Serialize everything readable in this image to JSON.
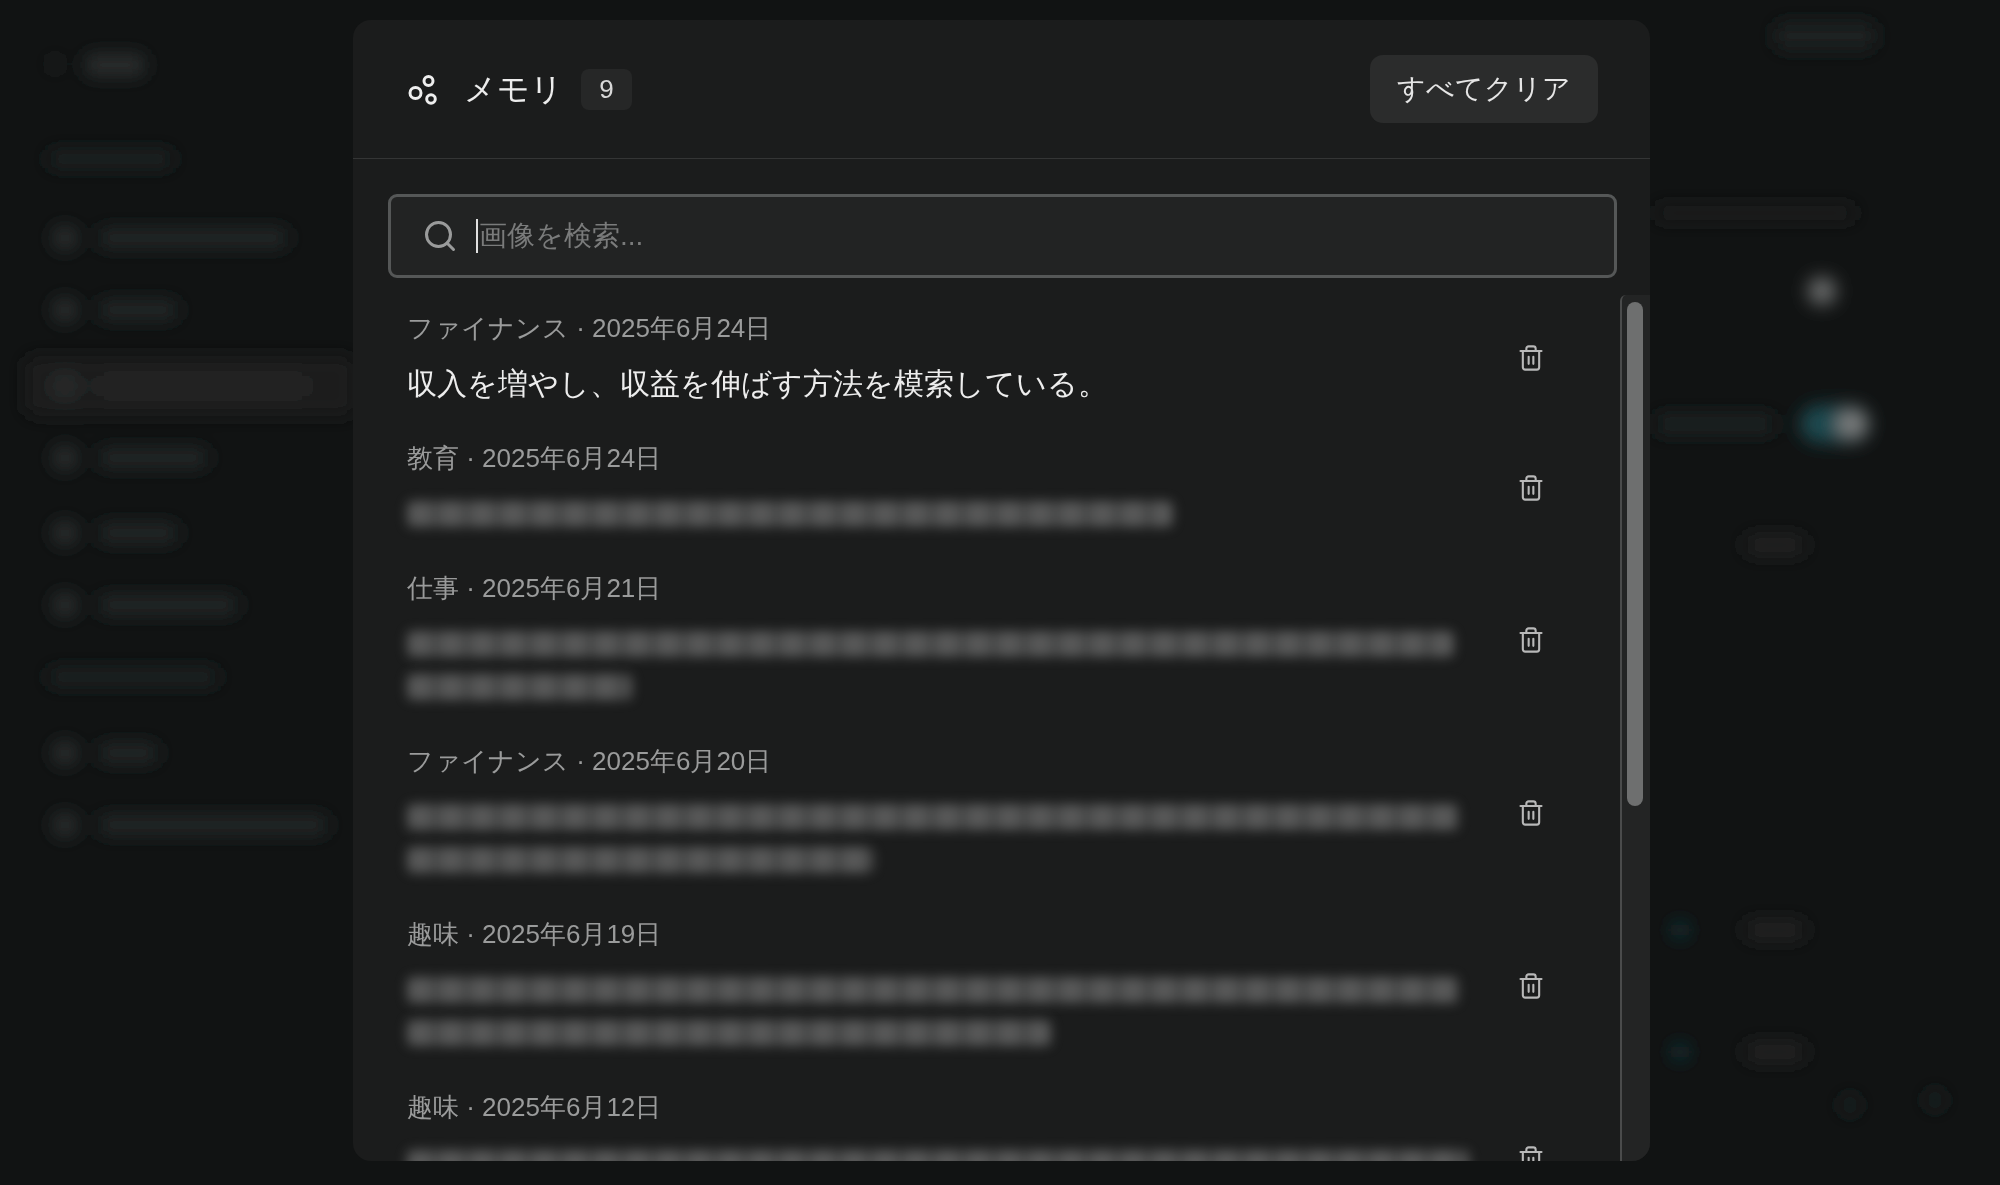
{
  "header": {
    "title": "メモリ",
    "count": "9",
    "clear_button": "すべてクリア"
  },
  "search": {
    "placeholder": "画像を検索...",
    "focused": true
  },
  "memories": [
    {
      "meta": "ファイナンス · 2025年6月24日",
      "text": "収入を増やし、収益を伸ばす方法を模索している。",
      "blurred": false
    },
    {
      "meta": "教育 · 2025年6月24日",
      "blurred": true
    },
    {
      "meta": "仕事 · 2025年6月21日",
      "blurred": true
    },
    {
      "meta": "ファイナンス · 2025年6月20日",
      "blurred": true
    },
    {
      "meta": "趣味 · 2025年6月19日",
      "blurred": true
    },
    {
      "meta": "趣味 · 2025年6月12日",
      "blurred": true
    }
  ]
}
